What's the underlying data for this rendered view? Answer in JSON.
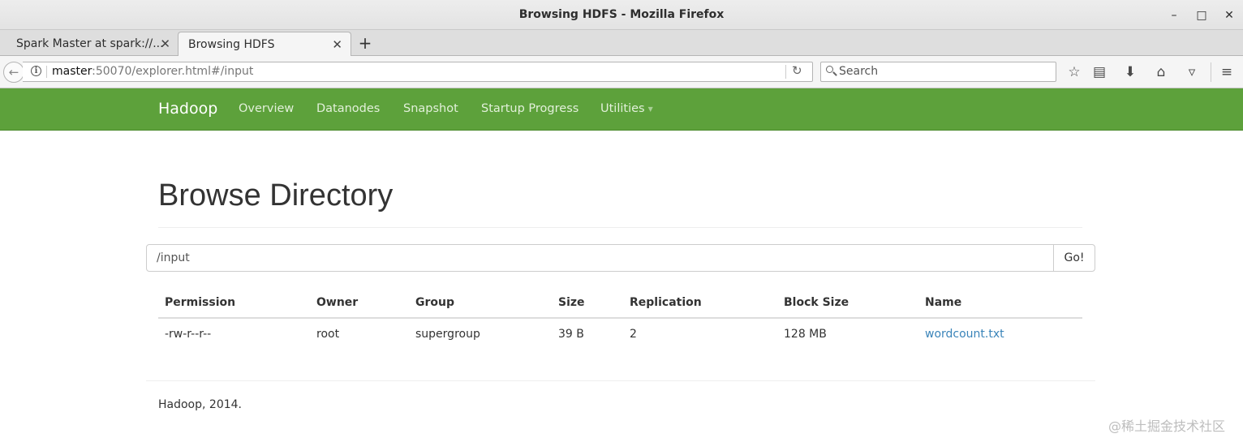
{
  "window": {
    "title": "Browsing HDFS - Mozilla Firefox",
    "minimize_glyph": "–",
    "maximize_glyph": "□",
    "close_glyph": "✕"
  },
  "tabs": [
    {
      "label": "Spark Master at spark://...",
      "active": false,
      "close_glyph": "✕"
    },
    {
      "label": "Browsing HDFS",
      "active": true,
      "close_glyph": "✕"
    }
  ],
  "new_tab_glyph": "+",
  "toolbar": {
    "url_host": "master",
    "url_rest": ":50070/explorer.html#/input",
    "search_placeholder": "Search",
    "icons": [
      "back-icon",
      "info-icon",
      "reload-icon",
      "search-icon",
      "bookmark-star-icon",
      "reading-list-icon",
      "download-icon",
      "home-icon",
      "pocket-icon",
      "menu-icon"
    ]
  },
  "hadoop_nav": {
    "brand": "Hadoop",
    "links": [
      "Overview",
      "Datanodes",
      "Snapshot",
      "Startup Progress",
      "Utilities"
    ],
    "bar_color": "#5da13b"
  },
  "page": {
    "heading": "Browse Directory",
    "path_value": "/input",
    "go_label": "Go!",
    "columns": [
      "Permission",
      "Owner",
      "Group",
      "Size",
      "Replication",
      "Block Size",
      "Name"
    ],
    "rows": [
      {
        "permission": "-rw-r--r--",
        "owner": "root",
        "group": "supergroup",
        "size": "39 B",
        "replication": "2",
        "block_size": "128 MB",
        "name": "wordcount.txt"
      }
    ],
    "link_color": "#3a84b9",
    "footer": "Hadoop, 2014."
  },
  "watermark": "@稀土掘金技术社区"
}
